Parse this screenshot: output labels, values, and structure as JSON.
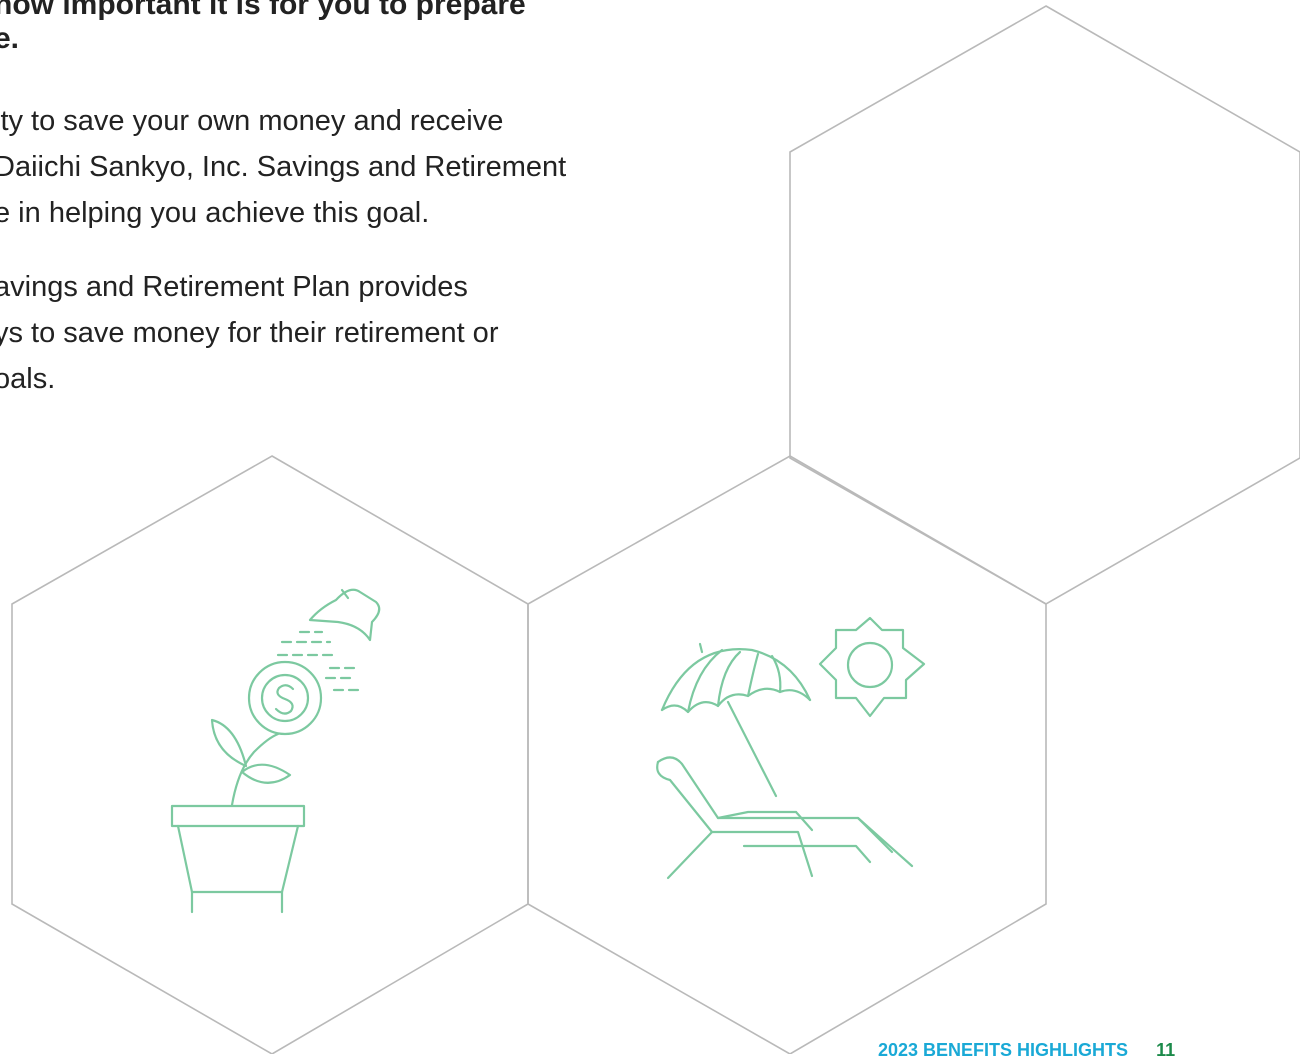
{
  "heading_lines": [
    "how important it is for you to prepare",
    "e."
  ],
  "paragraph1_lines": [
    "ity to save your own money and receive",
    " Daiichi Sankyo, Inc. Savings and Retirement",
    "e in helping you achieve this goal."
  ],
  "paragraph2_lines": [
    "avings and Retirement Plan provides",
    "ys to save money for their retirement or",
    "oals."
  ],
  "illustrations": {
    "left": "plant-with-dollar-coin-icon",
    "right": "beach-chair-umbrella-sun-icon"
  },
  "footer": {
    "title": "2023 BENEFITS HIGHLIGHTS",
    "page_number": "11"
  },
  "colors": {
    "icon_green": "#7cc9a0",
    "hexagon_outline": "#b9b9b9",
    "footer_title": "#1aa9d6",
    "footer_page": "#1b8a4a"
  }
}
